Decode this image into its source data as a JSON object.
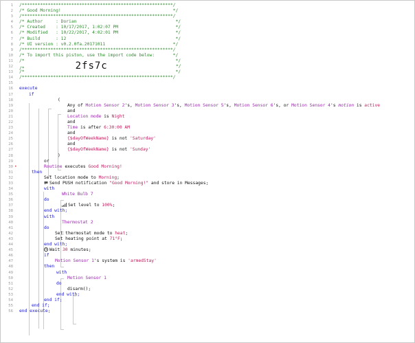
{
  "line_numbers": [
    "1",
    "2",
    "3",
    "4",
    "5",
    "6",
    "7",
    "8",
    "9",
    "10",
    "11",
    "12",
    "13",
    "14",
    "15",
    "16",
    "17",
    "18",
    "19",
    "20",
    "21",
    "22",
    "23",
    "24",
    "25",
    "26",
    "27",
    "28",
    "29",
    "30",
    "31",
    "32",
    "33",
    "34",
    "35",
    "36",
    "37",
    "38",
    "39",
    "40",
    "41",
    "42",
    "43",
    "44",
    "45",
    "46",
    "47",
    "48",
    "49",
    "50",
    "51",
    "52",
    "53",
    "54",
    "55",
    "56"
  ],
  "header": {
    "border": "/**********************************************************/",
    "title": "/* Good Morning!                                           */",
    "author": "/* Author     : Dorian                                      */",
    "created": "/* Created    : 10/17/2017, 1:02:07 PM                      */",
    "modified": "/* Modified   : 10/22/2017, 4:02:01 PM                      */",
    "build": "/* Build      : 12                                          */",
    "ui_version": "/* UI version : v0.2.0fa.20171011                          */",
    "import_text": "/* To import this piston, use the import code below:       */",
    "blank_a": "/*                                                          */",
    "code_prefix": "/*",
    "code_suffix": "*/",
    "import_code": "2fs7c",
    "blank_b": "/*                                                          */"
  },
  "kw": {
    "execute": "execute",
    "if": "if",
    "paren_open": "(",
    "paren_close": ")",
    "and": "and",
    "or": "or",
    "then": "then",
    "with": "with",
    "do": "do",
    "end_with": "end with;",
    "end_if": "end if;",
    "end_execute": "end execute;"
  },
  "cond": {
    "any_of": "Any of ",
    "dev1": "Motion Sensor 2",
    "s1": "'s, ",
    "dev2": "Motion Sensor 3",
    "s2": "'s, ",
    "dev3": "Motion Sensor 5",
    "s3": "'s, ",
    "dev4": "Motion Sensor 6",
    "s4": "'s, or ",
    "dev5": "Motion Sensor 4",
    "s5": "'s ",
    "attr": "motion",
    "is": " is ",
    "state": "active",
    "location_mode": "Location mode",
    "loc_is": " is ",
    "night": "Night",
    "time": "Time",
    "is_after": " is after ",
    "time_value": "6:30:00 AM",
    "dow_a": "{$dayOfWeekName}",
    "is_not_a": " is not ",
    "saturday": "'Saturday'",
    "dow_b": "{$dayOfWeekName}",
    "is_not_b": " is not ",
    "sunday": "'Sunday'",
    "routine": "Routine",
    "executes": " executes ",
    "routine_name": "Good Morning!"
  },
  "actions": {
    "set_mode_pre": "Set location mode to ",
    "set_mode_val": "Morning",
    "semi": ";",
    "push_pre": "Send PUSH notification ",
    "push_msg": "\"Good Morning!\"",
    "push_post": " and store in Messages;",
    "bulb": "White Bulb 7",
    "set_level_pre": "Set level to ",
    "set_level_val": "100%",
    "thermostat": "Thermostat 2",
    "thermo_mode_pre": "Set thermostat mode to ",
    "thermo_mode_val": "heat",
    "heat_pre": "Set heating point at ",
    "heat_val": "71°F",
    "wait_pre": "Wait ",
    "wait_val": "30",
    "wait_post": " minutes;",
    "sensor1": "Motion Sensor 1",
    "system_is": "'s system is ",
    "armed": "'armedStay'",
    "disarm": "disarm();"
  },
  "colors": {
    "comment": "#2e8b2e",
    "keyword": "#1a1ad0",
    "device": "#9c27b0",
    "value": "#c2185b"
  },
  "icons": {
    "push": "speech-bubble-icon",
    "level": "signal-bars-icon",
    "wait": "clock-icon"
  }
}
